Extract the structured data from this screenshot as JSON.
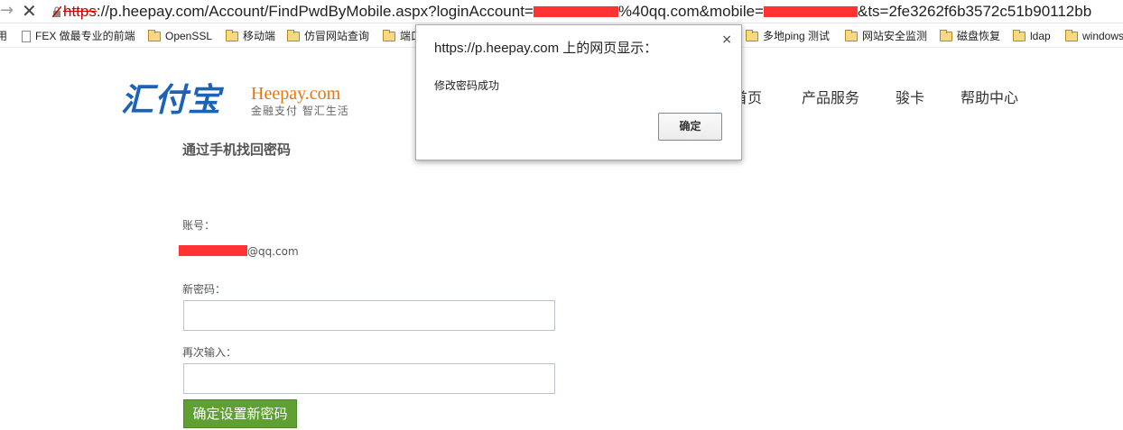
{
  "browser": {
    "url_scheme": "https",
    "url_part1": "://p.heepay.com/Account/FindPwdByMobile.aspx?loginAccount=",
    "url_part2": "%40qq.com&mobile=",
    "url_part3": "&ts=2fe3262f6b3572c51b90112bb"
  },
  "bookmarks": [
    {
      "label": "用"
    },
    {
      "label": "FEX 做最专业的前端"
    },
    {
      "label": "OpenSSL"
    },
    {
      "label": "移动端"
    },
    {
      "label": "仿冒网站查询"
    },
    {
      "label": "端口"
    },
    {
      "label": "多地ping 测试"
    },
    {
      "label": "网站安全监测"
    },
    {
      "label": "磁盘恢复"
    },
    {
      "label": "ldap"
    },
    {
      "label": "windows"
    }
  ],
  "site": {
    "logo_cn": "汇付宝",
    "logo_en": "Heepay.com",
    "logo_slogan": "金融支付 智汇生活",
    "nav": [
      "首页",
      "产品服务",
      "骏卡",
      "帮助中心"
    ]
  },
  "form": {
    "title": "通过手机找回密码",
    "account_label": "账号：",
    "account_suffix": "@qq.com",
    "new_password_label": "新密码：",
    "confirm_label": "再次输入：",
    "new_password_value": "",
    "confirm_value": "",
    "submit_label": "确定设置新密码"
  },
  "dialog": {
    "title": "https://p.heepay.com 上的网页显示：",
    "message": "修改密码成功",
    "ok_label": "确定",
    "close_glyph": "×"
  },
  "colors": {
    "brand_blue": "#1c63b7",
    "brand_orange": "#e8750e",
    "submit_green": "#5ea033",
    "redaction": "#ff3333"
  }
}
